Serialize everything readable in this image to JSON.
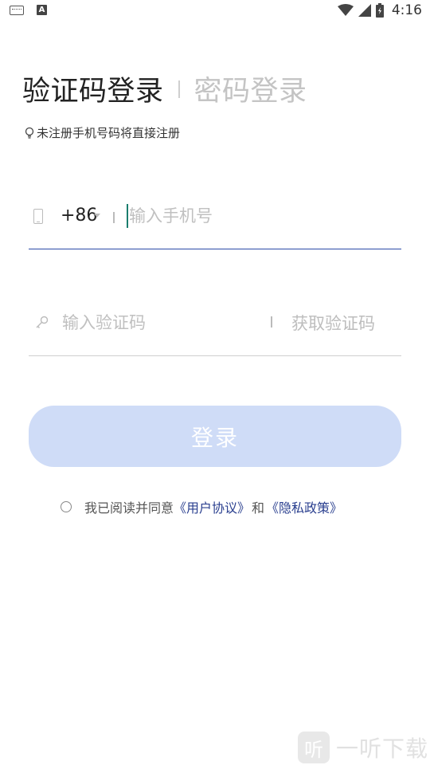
{
  "status_bar": {
    "time": "4:16",
    "left_icons": [
      "keyboard-icon",
      "a-icon"
    ],
    "a_letter": "A",
    "right_icons": [
      "wifi-icon",
      "signal-icon",
      "battery-icon"
    ]
  },
  "tabs": {
    "active": "验证码登录",
    "inactive": "密码登录"
  },
  "hint": "未注册手机号码将直接注册",
  "phone": {
    "country_code": "+86",
    "placeholder": "输入手机号",
    "value": ""
  },
  "code": {
    "placeholder": "输入验证码",
    "value": "",
    "get_code_label": "获取验证码"
  },
  "login_button": "登录",
  "agreement": {
    "prefix": "我已阅读并同意",
    "user_agreement": "《用户协议》",
    "and": "和",
    "privacy_policy": "《隐私政策》",
    "checked": false
  },
  "watermark": {
    "logo_glyph": "听",
    "text": "一听下载"
  },
  "colors": {
    "accent": "#2b4aa8",
    "button_disabled": "#cfdcf7",
    "link": "#2a3f8f",
    "cursor": "#1a7d6e"
  }
}
